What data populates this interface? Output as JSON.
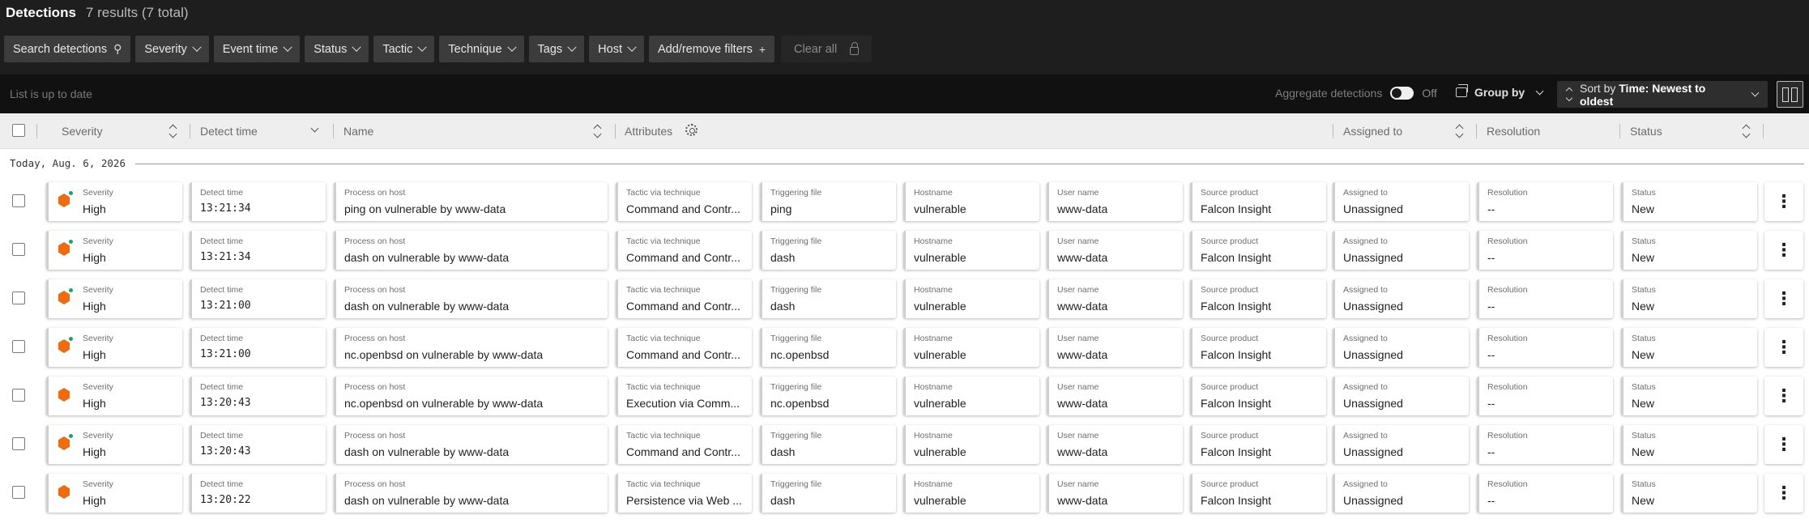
{
  "header": {
    "title": "Detections",
    "results": "7 results (7 total)"
  },
  "filters": {
    "search_label": "Search detections",
    "chips": [
      "Severity",
      "Event time",
      "Status",
      "Tactic",
      "Technique",
      "Tags",
      "Host"
    ],
    "add_remove_label": "Add/remove filters",
    "clear_all_label": "Clear all"
  },
  "toolbar": {
    "list_status": "List is up to date",
    "aggregate_label": "Aggregate detections",
    "aggregate_state": "Off",
    "group_by_label": "Group by",
    "sort_prefix": "Sort by",
    "sort_value": "Time: Newest to oldest"
  },
  "columns": {
    "severity": "Severity",
    "detect_time": "Detect time",
    "name": "Name",
    "attributes": "Attributes",
    "assigned_to": "Assigned to",
    "resolution": "Resolution",
    "status": "Status"
  },
  "date_group": "Today, Aug. 6, 2026",
  "field_labels": {
    "severity": "Severity",
    "detect_time": "Detect time",
    "process": "Process on host",
    "tactic": "Tactic via technique",
    "file": "Triggering file",
    "hostname": "Hostname",
    "user": "User name",
    "source": "Source product",
    "assigned": "Assigned to",
    "resolution": "Resolution",
    "status": "Status"
  },
  "rows": [
    {
      "severity": "High",
      "dot": true,
      "time": "13:21:34",
      "process": "ping on vulnerable by www-data",
      "tactic": "Command and Contr...",
      "file": "ping",
      "hostname": "vulnerable",
      "user": "www-data",
      "source": "Falcon Insight",
      "assigned": "Unassigned",
      "resolution": "--",
      "status": "New"
    },
    {
      "severity": "High",
      "dot": true,
      "time": "13:21:34",
      "process": "dash on vulnerable by www-data",
      "tactic": "Command and Contr...",
      "file": "dash",
      "hostname": "vulnerable",
      "user": "www-data",
      "source": "Falcon Insight",
      "assigned": "Unassigned",
      "resolution": "--",
      "status": "New"
    },
    {
      "severity": "High",
      "dot": true,
      "time": "13:21:00",
      "process": "dash on vulnerable by www-data",
      "tactic": "Command and Contr...",
      "file": "dash",
      "hostname": "vulnerable",
      "user": "www-data",
      "source": "Falcon Insight",
      "assigned": "Unassigned",
      "resolution": "--",
      "status": "New"
    },
    {
      "severity": "High",
      "dot": true,
      "time": "13:21:00",
      "process": "nc.openbsd on vulnerable by www-data",
      "tactic": "Command and Contr...",
      "file": "nc.openbsd",
      "hostname": "vulnerable",
      "user": "www-data",
      "source": "Falcon Insight",
      "assigned": "Unassigned",
      "resolution": "--",
      "status": "New"
    },
    {
      "severity": "High",
      "dot": false,
      "time": "13:20:43",
      "process": "nc.openbsd on vulnerable by www-data",
      "tactic": "Execution via Comm...",
      "file": "nc.openbsd",
      "hostname": "vulnerable",
      "user": "www-data",
      "source": "Falcon Insight",
      "assigned": "Unassigned",
      "resolution": "--",
      "status": "New"
    },
    {
      "severity": "High",
      "dot": true,
      "time": "13:20:43",
      "process": "dash on vulnerable by www-data",
      "tactic": "Command and Contr...",
      "file": "dash",
      "hostname": "vulnerable",
      "user": "www-data",
      "source": "Falcon Insight",
      "assigned": "Unassigned",
      "resolution": "--",
      "status": "New"
    },
    {
      "severity": "High",
      "dot": false,
      "time": "13:20:22",
      "process": "dash on vulnerable by www-data",
      "tactic": "Persistence via Web ...",
      "file": "dash",
      "hostname": "vulnerable",
      "user": "www-data",
      "source": "Falcon Insight",
      "assigned": "Unassigned",
      "resolution": "--",
      "status": "New"
    }
  ],
  "colors": {
    "severity_high": "#ee6c0e",
    "new_indicator": "#1f9e74",
    "header_bg": "#1e1e1e"
  },
  "icons": {
    "search": "search-icon",
    "add": "plus-icon",
    "clear": "lock-icon",
    "attributes": "gear-icon",
    "row_menu": "kebab-icon"
  }
}
